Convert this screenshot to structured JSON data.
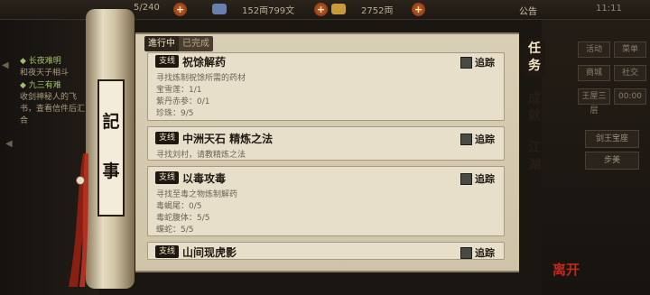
{
  "topbar": {
    "energy": "5/240",
    "silver": "152両799文",
    "gold": "2752両",
    "announce": "公告",
    "time": "11:11"
  },
  "left_panel": {
    "items": [
      {
        "head": "◆ 长夜难明",
        "desc": "和夜天子相斗"
      },
      {
        "head": "◆ 九三有难",
        "desc": "收剑神秘人的飞书，查看信件后汇合"
      }
    ]
  },
  "right_panel": {
    "buttons": [
      "活动",
      "菜单",
      "商城",
      "社交",
      "王屋三层",
      "00:00"
    ],
    "sword_label": "剑王宝座",
    "walk_label": "步美"
  },
  "scroll": {
    "title_chars": [
      "記",
      "事"
    ]
  },
  "tabs": {
    "active": "進行中",
    "done": "已完成"
  },
  "side_tabs": [
    {
      "label": "任务"
    },
    {
      "label": "成就"
    },
    {
      "label": "江湖"
    }
  ],
  "quests": [
    {
      "badge": "支线",
      "title": "祝馀解药",
      "track": "追踪",
      "lines": [
        "寻找炼制祝馀所需的药材",
        "宝雪莲：1/1",
        "紫丹赤参：0/1",
        "珍珠：9/5"
      ]
    },
    {
      "badge": "支线",
      "title": "中洲天石 精炼之法",
      "track": "追踪",
      "lines": [
        "寻找刘村，请教精炼之法"
      ]
    },
    {
      "badge": "支线",
      "title": "以毒攻毒",
      "track": "追踪",
      "lines": [
        "寻找至毒之物炼制解药",
        "毒蝎尾：0/5",
        "毒蛇腹体：5/5",
        "蝶蛇：5/5"
      ]
    },
    {
      "badge": "支线",
      "title": "山间现虎影",
      "track": "追踪",
      "lines": []
    }
  ],
  "seal_text": "离开",
  "colors": {
    "accent_green": "#9fc06a",
    "seal_red": "#c0281e",
    "paper": "#e7dfca"
  }
}
